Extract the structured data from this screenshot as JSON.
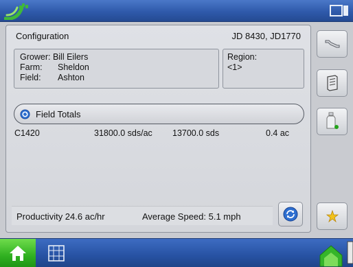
{
  "topbar": {
    "gps_icon": "satellite-signal-icon",
    "window_icon": "window-switch-icon"
  },
  "config": {
    "label": "Configuration",
    "value": "JD 8430, JD1770"
  },
  "gff": {
    "grower_key": "Grower:",
    "grower_value": "Bill Eilers",
    "farm_key": "Farm:",
    "farm_value": "Sheldon",
    "field_key": "Field:",
    "field_value": "Ashton"
  },
  "region": {
    "label": "Region:",
    "value": "<1>"
  },
  "field_totals": {
    "label": "Field Totals"
  },
  "totals_row": {
    "product": "C1420",
    "rate": "31800.0 sds/ac",
    "total": "13700.0 sds",
    "area": "0.4 ac"
  },
  "status": {
    "productivity": "Productivity 24.6 ac/hr",
    "speed": "Average Speed:  5.1 mph"
  },
  "side_buttons": [
    "wrench-icon",
    "manual-icon",
    "product-bottle-icon",
    "new-star-icon"
  ],
  "colors": {
    "topbar": "#2f5aab",
    "home": "#2fb020",
    "accent_blue": "#2e6fd0"
  }
}
